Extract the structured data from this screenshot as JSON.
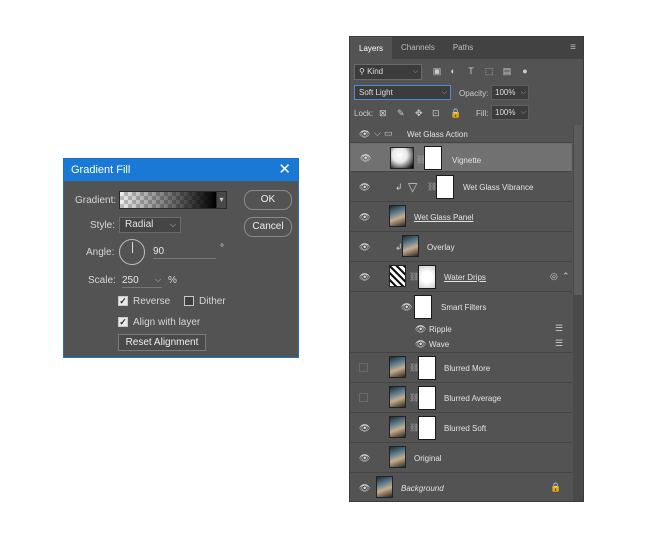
{
  "dialog": {
    "title": "Gradient Fill",
    "gradient_label": "Gradient:",
    "style_label": "Style:",
    "style_value": "Radial",
    "angle_label": "Angle:",
    "angle_value": "90",
    "degree_symbol": "°",
    "scale_label": "Scale:",
    "scale_value": "250",
    "percent_symbol": "%",
    "reverse_label": "Reverse",
    "reverse_checked": true,
    "dither_label": "Dither",
    "dither_checked": false,
    "align_label": "Align with layer",
    "align_checked": true,
    "reset_button": "Reset Alignment",
    "ok_button": "OK",
    "cancel_button": "Cancel",
    "close_glyph": "✕"
  },
  "panel": {
    "tabs": [
      "Layers",
      "Channels",
      "Paths"
    ],
    "menu_glyph": "≡",
    "kind_label": "Kind",
    "blend_mode": "Soft Light",
    "opacity_label": "Opacity:",
    "opacity_value": "100%",
    "lock_label": "Lock:",
    "fill_label": "Fill:",
    "fill_value": "100%",
    "layers": [
      {
        "name": "Wet Glass Action"
      },
      {
        "name": "Vignette"
      },
      {
        "name": "Wet Glass Vibrance"
      },
      {
        "name": "Wet Glass Panel"
      },
      {
        "name": "Overlay"
      },
      {
        "name": "Water Drips"
      },
      {
        "name": "Smart Filters"
      },
      {
        "name": "Ripple"
      },
      {
        "name": "Wave"
      },
      {
        "name": "Blurred More"
      },
      {
        "name": "Blurred Average"
      },
      {
        "name": "Blurred Soft"
      },
      {
        "name": "Original"
      },
      {
        "name": "Background"
      }
    ]
  },
  "colors": {
    "dialog_title_bar": "#1979d4",
    "panel_bg": "#535353",
    "selected_row": "#717171"
  }
}
